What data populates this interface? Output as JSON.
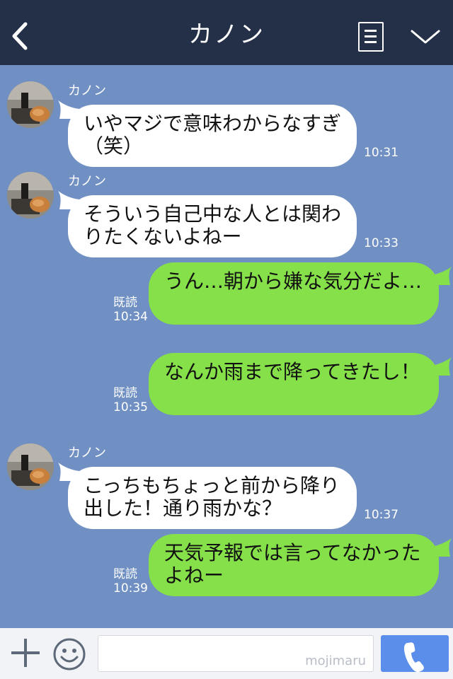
{
  "header": {
    "title": "カノン"
  },
  "messages": [
    {
      "direction": "in",
      "sender": "カノン",
      "text": "いやマジで意味わからなすぎ（笑）",
      "time": "10:31"
    },
    {
      "direction": "in",
      "sender": "カノン",
      "text": "そういう自己中な人とは関わりたくないよねー",
      "time": "10:33"
    },
    {
      "direction": "out",
      "read": "既読",
      "text": "うん…朝から嫌な気分だよ…",
      "time": "10:34"
    },
    {
      "direction": "out",
      "read": "既読",
      "text": "なんか雨まで降ってきたし！",
      "time": "10:35"
    },
    {
      "direction": "in",
      "sender": "カノン",
      "text": "こっちもちょっと前から降り出した！通り雨かな？",
      "time": "10:37"
    },
    {
      "direction": "out",
      "read": "既読",
      "text": "天気予報では言ってなかったよねー",
      "time": "10:39"
    }
  ],
  "footer": {
    "watermark": "mojimaru"
  },
  "icons": {
    "back": "chevron-left-icon",
    "menu": "menu-icon",
    "expand": "chevron-down-icon",
    "add": "plus-icon",
    "emoji": "smiley-icon",
    "call": "phone-icon"
  },
  "colors": {
    "header": "#243047",
    "background": "#7090c4",
    "incoming_bubble": "#ffffff",
    "outgoing_bubble": "#86e04a",
    "call_button": "#5b8dea"
  }
}
